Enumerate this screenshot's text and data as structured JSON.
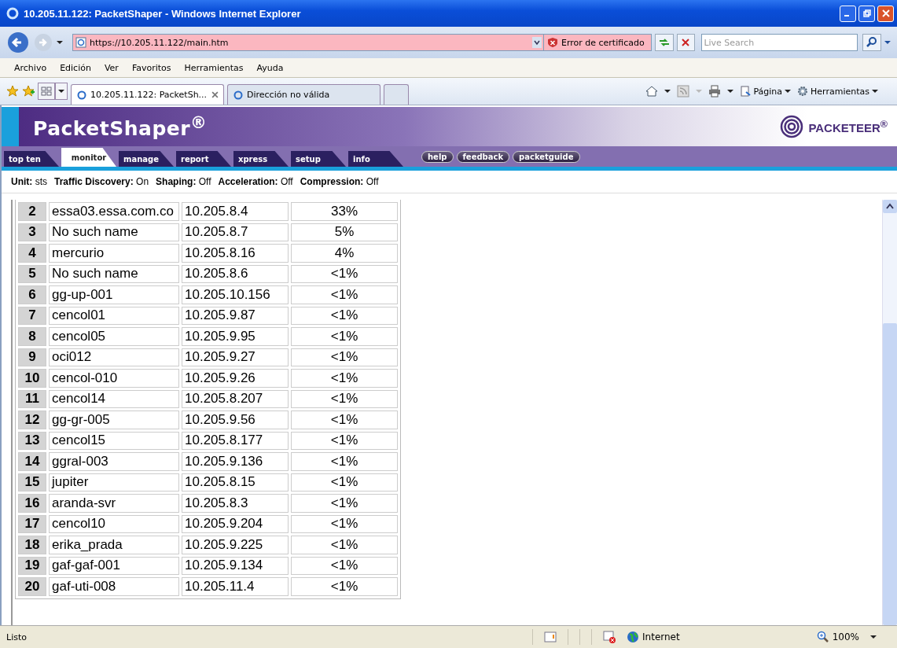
{
  "window": {
    "title": "10.205.11.122: PacketShaper - Windows Internet Explorer"
  },
  "address_bar": {
    "url": "https://10.205.11.122/main.htm",
    "certificate_error": "Error de certificado",
    "search_placeholder": "Live Search"
  },
  "menu": [
    "Archivo",
    "Edición",
    "Ver",
    "Favoritos",
    "Herramientas",
    "Ayuda"
  ],
  "browser_tabs": [
    {
      "label": "10.205.11.122: PacketSh...",
      "selected": true
    },
    {
      "label": "Dirección no válida",
      "selected": false
    }
  ],
  "command_bar": {
    "page": "Página",
    "tools": "Herramientas"
  },
  "page": {
    "brand": "PacketShaper$^{®}$",
    "logo": "PACKETEER$^{®}$",
    "nav_tabs": [
      {
        "label": "top ten",
        "selected": false
      },
      {
        "label": "monitor",
        "selected": true
      },
      {
        "label": "manage",
        "selected": false
      },
      {
        "label": "report",
        "selected": false
      },
      {
        "label": "xpress",
        "selected": false
      },
      {
        "label": "setup",
        "selected": false
      },
      {
        "label": "info",
        "selected": false
      }
    ],
    "nav_buttons": [
      "help",
      "feedback",
      "packetguide"
    ],
    "status": [
      {
        "label": "Unit:",
        "value": "sts"
      },
      {
        "label": "Traffic Discovery:",
        "value": "On"
      },
      {
        "label": "Shaping:",
        "value": "Off"
      },
      {
        "label": "Acceleration:",
        "value": "Off"
      },
      {
        "label": "Compression:",
        "value": "Off"
      }
    ],
    "rows": [
      [
        "2",
        "essa03.essa.com.co",
        "10.205.8.4",
        "33%"
      ],
      [
        "3",
        "No such name",
        "10.205.8.7",
        "5%"
      ],
      [
        "4",
        "mercurio",
        "10.205.8.16",
        "4%"
      ],
      [
        "5",
        "No such name",
        "10.205.8.6",
        "<1%"
      ],
      [
        "6",
        "gg-up-001",
        "10.205.10.156",
        "<1%"
      ],
      [
        "7",
        "cencol01",
        "10.205.9.87",
        "<1%"
      ],
      [
        "8",
        "cencol05",
        "10.205.9.95",
        "<1%"
      ],
      [
        "9",
        "oci012",
        "10.205.9.27",
        "<1%"
      ],
      [
        "10",
        "cencol-010",
        "10.205.9.26",
        "<1%"
      ],
      [
        "11",
        "cencol14",
        "10.205.8.207",
        "<1%"
      ],
      [
        "12",
        "gg-gr-005",
        "10.205.9.56",
        "<1%"
      ],
      [
        "13",
        "cencol15",
        "10.205.8.177",
        "<1%"
      ],
      [
        "14",
        "ggral-003",
        "10.205.9.136",
        "<1%"
      ],
      [
        "15",
        "jupiter",
        "10.205.8.15",
        "<1%"
      ],
      [
        "16",
        "aranda-svr",
        "10.205.8.3",
        "<1%"
      ],
      [
        "17",
        "cencol10",
        "10.205.9.204",
        "<1%"
      ],
      [
        "18",
        "erika_prada",
        "10.205.9.225",
        "<1%"
      ],
      [
        "19",
        "gaf-gaf-001",
        "10.205.9.134",
        "<1%"
      ],
      [
        "20",
        "gaf-uti-008",
        "10.205.11.4",
        "<1%"
      ]
    ]
  },
  "status_bar": {
    "text": "Listo",
    "zone": "Internet",
    "zoom": "100%"
  }
}
